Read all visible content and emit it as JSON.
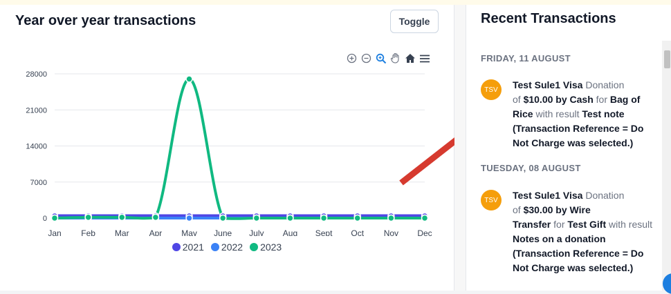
{
  "chart_card": {
    "title": "Year over year transactions",
    "toggle_label": "Toggle"
  },
  "toolbar": [
    "zoom-in-icon",
    "zoom-out-icon",
    "selection-zoom-icon",
    "pan-icon",
    "home-icon",
    "menu-icon"
  ],
  "chart_data": {
    "type": "line",
    "categories": [
      "Jan",
      "Feb",
      "Mar",
      "Apr",
      "May",
      "June",
      "July",
      "Aug",
      "Sept",
      "Oct",
      "Nov",
      "Dec"
    ],
    "y_ticks": [
      "0",
      "7000",
      "14000",
      "21000",
      "28000"
    ],
    "ylim": [
      0,
      28000
    ],
    "grid": true,
    "legend_position": "bottom",
    "series": [
      {
        "name": "2021",
        "color": "#4f46e5",
        "values": [
          400,
          400,
          400,
          400,
          400,
          400,
          400,
          400,
          400,
          400,
          400,
          400
        ]
      },
      {
        "name": "2022",
        "color": "#3b82f6",
        "values": [
          0,
          0,
          0,
          0,
          0,
          0,
          0,
          0,
          0,
          0,
          0,
          0
        ]
      },
      {
        "name": "2023",
        "color": "#10b981",
        "values": [
          0,
          150,
          150,
          150,
          27000,
          0,
          0,
          0,
          0,
          0,
          0,
          0
        ]
      }
    ]
  },
  "recent": {
    "title": "Recent Transactions",
    "groups": [
      {
        "date": "FRIDAY, 11 AUGUST",
        "avatar": "TSV",
        "lines": [
          [
            {
              "b": true,
              "t": "Test Sule1 Visa"
            },
            {
              "b": false,
              "t": " Donation"
            }
          ],
          [
            {
              "b": false,
              "t": "of "
            },
            {
              "b": true,
              "t": "$10.00 by Cash"
            },
            {
              "b": false,
              "t": " for "
            },
            {
              "b": true,
              "t": "Bag of"
            }
          ],
          [
            {
              "b": true,
              "t": "Rice"
            },
            {
              "b": false,
              "t": " with result "
            },
            {
              "b": true,
              "t": "Test note"
            }
          ],
          [
            {
              "b": true,
              "t": "(Transaction Reference = Do"
            }
          ],
          [
            {
              "b": true,
              "t": "Not Charge was selected.)"
            }
          ]
        ]
      },
      {
        "date": "TUESDAY, 08 AUGUST",
        "avatar": "TSV",
        "lines": [
          [
            {
              "b": true,
              "t": "Test Sule1 Visa"
            },
            {
              "b": false,
              "t": " Donation"
            }
          ],
          [
            {
              "b": false,
              "t": "of "
            },
            {
              "b": true,
              "t": "$30.00 by Wire"
            }
          ],
          [
            {
              "b": true,
              "t": "Transfer"
            },
            {
              "b": false,
              "t": " for "
            },
            {
              "b": true,
              "t": "Test Gift"
            },
            {
              "b": false,
              "t": " with result"
            }
          ],
          [
            {
              "b": true,
              "t": "Notes on a donation"
            }
          ],
          [
            {
              "b": true,
              "t": "(Transaction Reference = Do"
            }
          ],
          [
            {
              "b": true,
              "t": "Not Charge was selected.)"
            }
          ]
        ]
      }
    ]
  },
  "colors": {
    "accent_arrow": "#d63a2f",
    "avatar": "#f59e0b"
  }
}
